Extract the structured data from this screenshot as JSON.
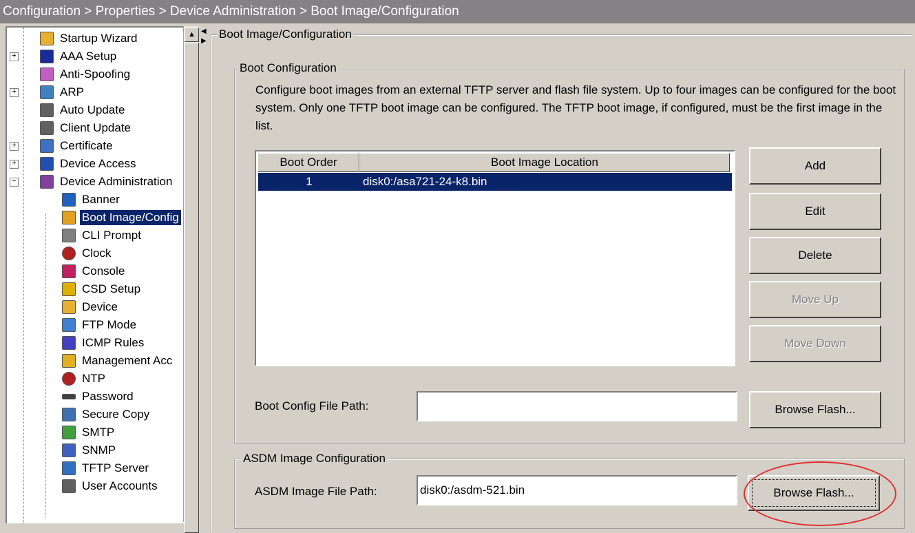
{
  "title_bar": "Configuration > Properties > Device Administration > Boot Image/Configuration",
  "tree": {
    "items": [
      {
        "label": "Startup Wizard",
        "icon": "wizard-icon",
        "color": "#e8b030"
      },
      {
        "label": "AAA Setup",
        "icon": "lock-icon",
        "color": "#1a2a9a"
      },
      {
        "label": "Anti-Spoofing",
        "icon": "shield-icon",
        "color": "#c060c0"
      },
      {
        "label": "ARP",
        "icon": "network-icon",
        "color": "#4080c0"
      },
      {
        "label": "Auto Update",
        "icon": "computer-icon",
        "color": "#606060"
      },
      {
        "label": "Client Update",
        "icon": "computer-icon",
        "color": "#606060"
      },
      {
        "label": "Certificate",
        "icon": "certificate-icon",
        "color": "#4070c0"
      },
      {
        "label": "Device Access",
        "icon": "key-icon",
        "color": "#2050b0"
      },
      {
        "label": "Device Administration",
        "icon": "admin-icon",
        "color": "#8040a0"
      },
      {
        "label": "Banner",
        "icon": "banner-icon",
        "color": "#2060c0"
      },
      {
        "label": "Boot Image/Config",
        "icon": "boot-icon",
        "color": "#e0a020"
      },
      {
        "label": "CLI Prompt",
        "icon": "prompt-icon",
        "color": "#808080"
      },
      {
        "label": "Clock",
        "icon": "clock-icon",
        "color": "#b02020"
      },
      {
        "label": "Console",
        "icon": "console-icon",
        "color": "#c02060"
      },
      {
        "label": "CSD Setup",
        "icon": "lock-icon",
        "color": "#e0b000"
      },
      {
        "label": "Device",
        "icon": "device-icon",
        "color": "#e8b030"
      },
      {
        "label": "FTP Mode",
        "icon": "ftp-icon",
        "color": "#4080d0"
      },
      {
        "label": "ICMP Rules",
        "icon": "icmp-icon",
        "color": "#4040c0"
      },
      {
        "label": "Management Acc",
        "icon": "management-icon",
        "color": "#e0b020"
      },
      {
        "label": "NTP",
        "icon": "clock-icon",
        "color": "#b02020"
      },
      {
        "label": "Password",
        "icon": "password-icon",
        "color": "#404040"
      },
      {
        "label": "Secure Copy",
        "icon": "copy-icon",
        "color": "#4070b0"
      },
      {
        "label": "SMTP",
        "icon": "smtp-icon",
        "color": "#40a040"
      },
      {
        "label": "SNMP",
        "icon": "snmp-icon",
        "color": "#4060c0"
      },
      {
        "label": "TFTP Server",
        "icon": "server-icon",
        "color": "#3070c0"
      },
      {
        "label": "User Accounts",
        "icon": "users-icon",
        "color": "#606060"
      }
    ]
  },
  "panel": {
    "title": "Boot Image/Configuration",
    "boot_config": {
      "legend": "Boot Configuration",
      "description": "Configure boot images from an external TFTP server and flash file system. Up to four images can be configured for the boot system. Only one TFTP boot image can be configured. The TFTP boot image, if configured, must be the first image in the list.",
      "table": {
        "headers": [
          "Boot Order",
          "Boot Image Location"
        ],
        "rows": [
          {
            "order": "1",
            "location": "disk0:/asa721-24-k8.bin"
          }
        ]
      },
      "buttons": {
        "add": "Add",
        "edit": "Edit",
        "delete": "Delete",
        "move_up": "Move Up",
        "move_down": "Move Down"
      },
      "config_path_label": "Boot Config File Path:",
      "config_path_value": "",
      "browse_label": "Browse Flash..."
    },
    "asdm": {
      "legend": "ASDM Image Configuration",
      "path_label": "ASDM Image File Path:",
      "path_value": "disk0:/asdm-521.bin",
      "browse_label": "Browse Flash..."
    }
  },
  "colors": {
    "title_bar": "#848284",
    "selection": "#0a246a",
    "highlight_circle": "#e03030"
  }
}
